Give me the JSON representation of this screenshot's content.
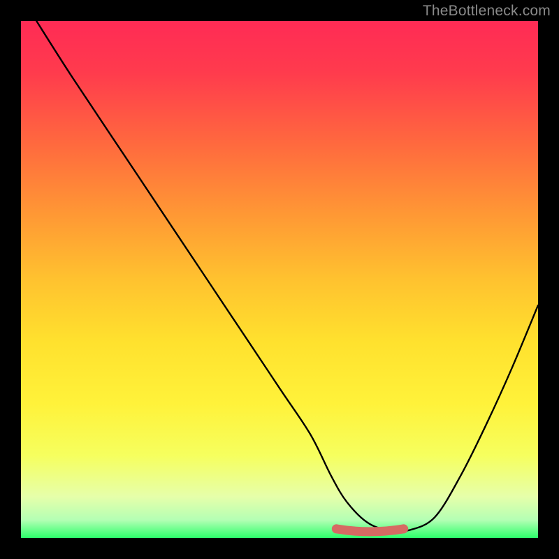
{
  "watermark": "TheBottleneck.com",
  "chart_data": {
    "type": "line",
    "title": "",
    "xlabel": "",
    "ylabel": "",
    "xlim": [
      0,
      100
    ],
    "ylim": [
      0,
      100
    ],
    "series": [
      {
        "name": "curve",
        "color": "#000000",
        "x": [
          3,
          10,
          20,
          30,
          40,
          50,
          56,
          60,
          63,
          67,
          71,
          75,
          80,
          85,
          90,
          95,
          100
        ],
        "y": [
          100,
          89,
          74,
          59,
          44,
          29,
          20,
          12,
          7,
          3,
          1.5,
          1.5,
          4,
          12,
          22,
          33,
          45
        ]
      },
      {
        "name": "highlight-band",
        "color": "#d66a63",
        "x": [
          61,
          74
        ],
        "y": [
          1.5,
          1.5
        ]
      }
    ]
  }
}
